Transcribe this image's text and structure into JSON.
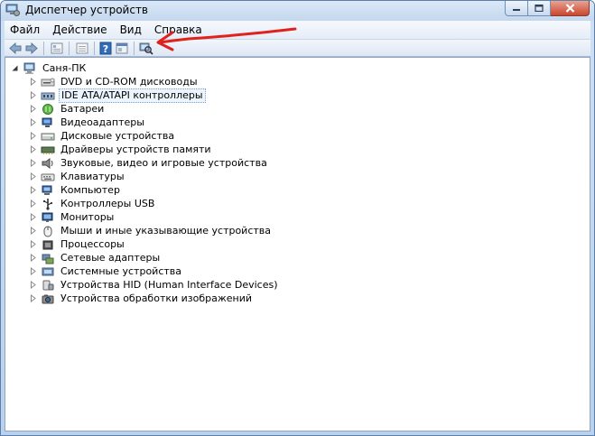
{
  "window": {
    "title": "Диспетчер устройств"
  },
  "menu": {
    "items": [
      "Файл",
      "Действие",
      "Вид",
      "Справка"
    ]
  },
  "toolbar": {
    "buttons": [
      "back-arrow-icon",
      "forward-arrow-icon",
      "properties-icon",
      "list-icon",
      "help-icon",
      "view-icon",
      "scan-hardware-icon"
    ]
  },
  "tree": {
    "root_label": "Саня-ПК",
    "selected_index": 1,
    "items": [
      {
        "label": "DVD и CD-ROM дисководы",
        "icon": "dvd-drive-icon"
      },
      {
        "label": "IDE ATA/ATAPI контроллеры",
        "icon": "ide-controller-icon"
      },
      {
        "label": "Батареи",
        "icon": "battery-icon"
      },
      {
        "label": "Видеоадаптеры",
        "icon": "display-adapter-icon"
      },
      {
        "label": "Дисковые устройства",
        "icon": "disk-drive-icon"
      },
      {
        "label": "Драйверы устройств памяти",
        "icon": "memory-driver-icon"
      },
      {
        "label": "Звуковые, видео и игровые устройства",
        "icon": "sound-icon"
      },
      {
        "label": "Клавиатуры",
        "icon": "keyboard-icon"
      },
      {
        "label": "Компьютер",
        "icon": "computer-icon"
      },
      {
        "label": "Контроллеры USB",
        "icon": "usb-icon"
      },
      {
        "label": "Мониторы",
        "icon": "monitor-icon"
      },
      {
        "label": "Мыши и иные указывающие устройства",
        "icon": "mouse-icon"
      },
      {
        "label": "Процессоры",
        "icon": "processor-icon"
      },
      {
        "label": "Сетевые адаптеры",
        "icon": "network-adapter-icon"
      },
      {
        "label": "Системные устройства",
        "icon": "system-device-icon"
      },
      {
        "label": "Устройства HID (Human Interface Devices)",
        "icon": "hid-icon"
      },
      {
        "label": "Устройства обработки изображений",
        "icon": "imaging-device-icon"
      }
    ]
  },
  "colors": {
    "annotation_arrow": "#e0211c",
    "selection_border": "#7aa0d2"
  }
}
